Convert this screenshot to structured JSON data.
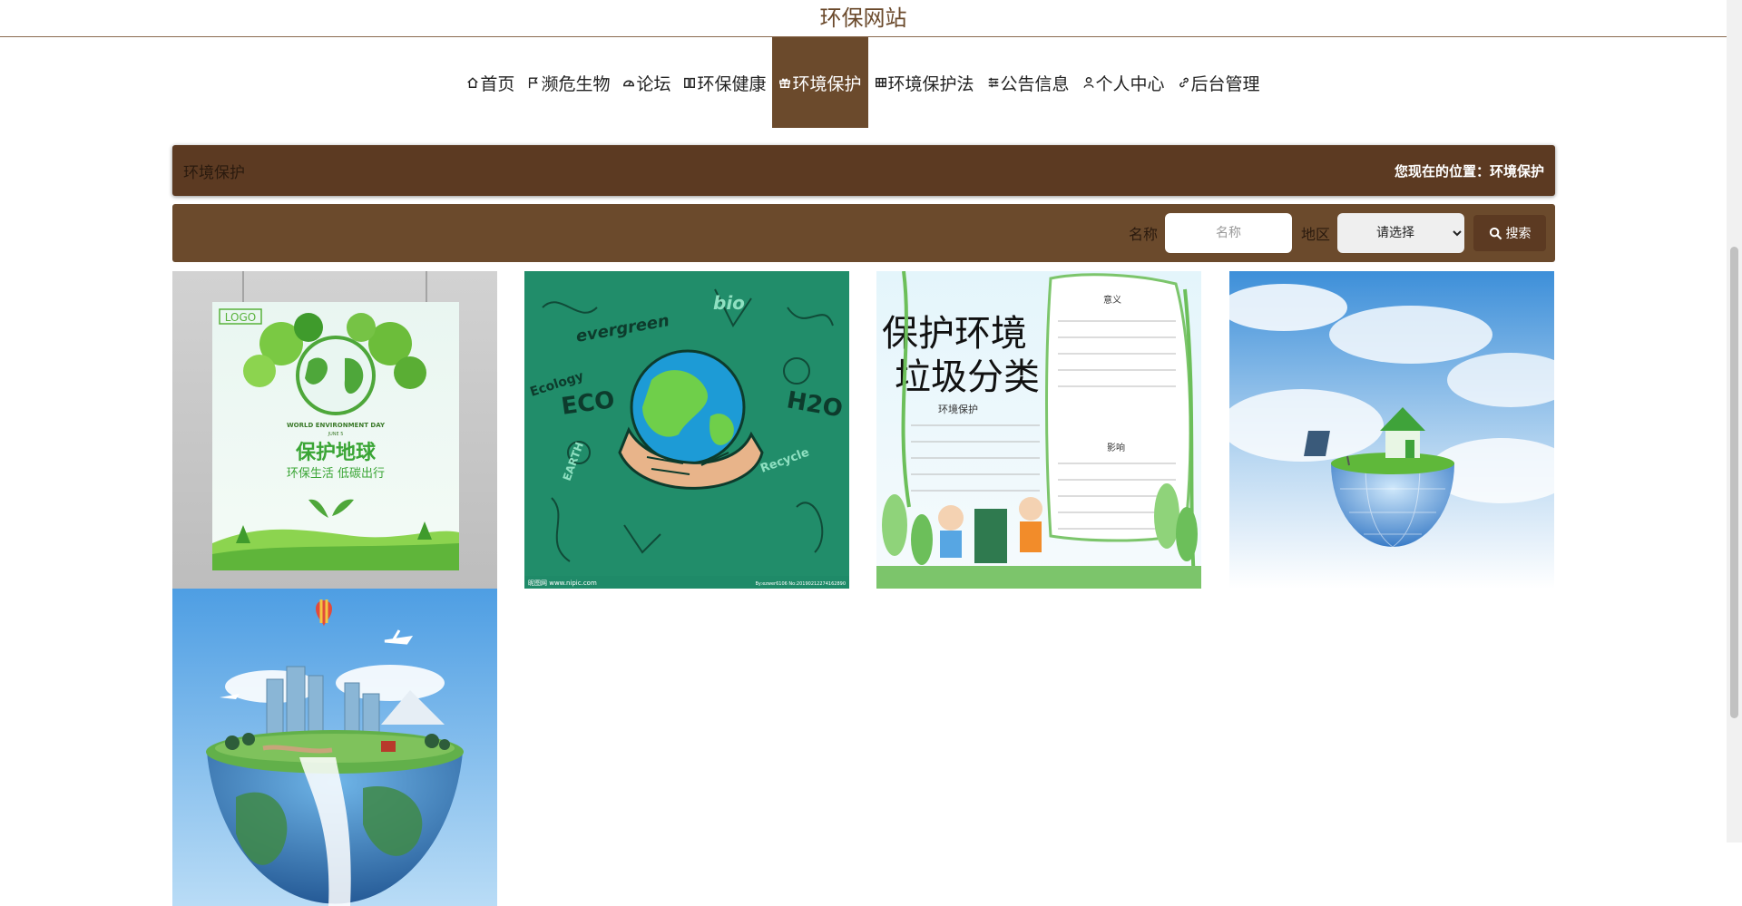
{
  "site": {
    "title": "环保网站"
  },
  "nav": {
    "items": [
      {
        "label": "首页",
        "icon": "home-icon"
      },
      {
        "label": "濒危生物",
        "icon": "flag-icon"
      },
      {
        "label": "论坛",
        "icon": "dashboard-icon"
      },
      {
        "label": "环保健康",
        "icon": "book-icon"
      },
      {
        "label": "环境保护",
        "icon": "gift-icon",
        "active": true
      },
      {
        "label": "环境保护法",
        "icon": "grid-icon"
      },
      {
        "label": "公告信息",
        "icon": "sliders-icon"
      },
      {
        "label": "个人中心",
        "icon": "user-icon"
      },
      {
        "label": "后台管理",
        "icon": "link-icon"
      }
    ]
  },
  "breadcrumb": {
    "section": "环境保护",
    "location": "您现在的位置：环境保护"
  },
  "search": {
    "name_label": "名称",
    "name_placeholder": "名称",
    "region_label": "地区",
    "region_selected": "请选择",
    "button_label": "搜索"
  },
  "gallery": {
    "items": [
      {
        "poster_logo": "LOGO",
        "poster_title": "保护地球",
        "poster_subtitle": "环保生活  低碳出行",
        "poster_day": "WORLD ENVIRONMENT DAY",
        "poster_date": "JUNE 5"
      },
      {
        "words": [
          "evergreen",
          "ECO",
          "Ecology",
          "bio",
          "H2O",
          "EARTH",
          "Recycle"
        ],
        "footer_left": "昵图网 www.nipic.com",
        "footer_right": "By:ezwer6106 No:20190212274162890"
      },
      {
        "title_line1": "保护环境",
        "title_line2": "垃圾分类",
        "section1": "意义",
        "section2": "环境保护",
        "section3": "影响"
      },
      {
        "description": "globe-house-solar"
      },
      {
        "description": "floating-earth-city"
      }
    ]
  },
  "colors": {
    "primary": "#6b4a2c",
    "dark": "#5c3a22"
  }
}
